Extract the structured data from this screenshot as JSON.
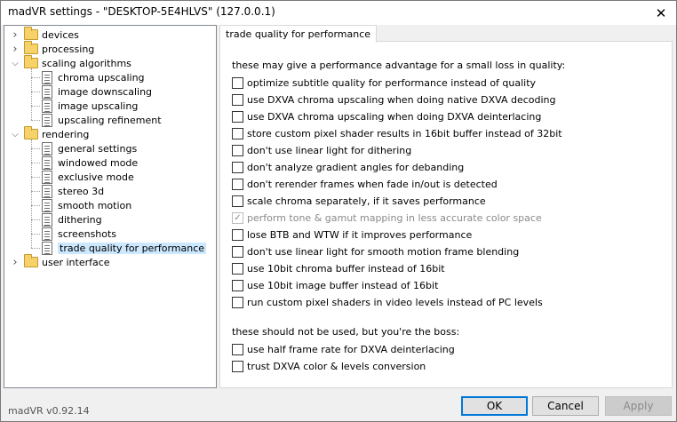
{
  "window": {
    "title": "madVR settings - \"DESKTOP-5E4HLVS\" (127.0.0.1)",
    "close_glyph": "✕"
  },
  "tree": {
    "items": [
      {
        "label": "devices",
        "type": "folder"
      },
      {
        "label": "processing",
        "type": "folder"
      },
      {
        "label": "scaling algorithms",
        "type": "folder"
      },
      {
        "label": "chroma upscaling",
        "type": "page"
      },
      {
        "label": "image downscaling",
        "type": "page"
      },
      {
        "label": "image upscaling",
        "type": "page"
      },
      {
        "label": "upscaling refinement",
        "type": "page"
      },
      {
        "label": "rendering",
        "type": "folder"
      },
      {
        "label": "general settings",
        "type": "page"
      },
      {
        "label": "windowed mode",
        "type": "page"
      },
      {
        "label": "exclusive mode",
        "type": "page"
      },
      {
        "label": "stereo 3d",
        "type": "page"
      },
      {
        "label": "smooth motion",
        "type": "page"
      },
      {
        "label": "dithering",
        "type": "page"
      },
      {
        "label": "screenshots",
        "type": "page"
      },
      {
        "label": "trade quality for performance",
        "type": "page",
        "selected": true
      },
      {
        "label": "user interface",
        "type": "folder"
      }
    ]
  },
  "panel": {
    "tab_label": "trade quality for performance",
    "section1_heading": "these may give a performance advantage for a small loss in quality:",
    "section1_options": [
      {
        "label": "optimize subtitle quality for performance instead of quality",
        "checked": false
      },
      {
        "label": "use DXVA chroma upscaling when doing native DXVA decoding",
        "checked": false
      },
      {
        "label": "use DXVA chroma upscaling when doing DXVA deinterlacing",
        "checked": false
      },
      {
        "label": "store custom pixel shader results in 16bit buffer instead of 32bit",
        "checked": false
      },
      {
        "label": "don't use linear light for dithering",
        "checked": false
      },
      {
        "label": "don't analyze gradient angles for debanding",
        "checked": false
      },
      {
        "label": "don't rerender frames when fade in/out is detected",
        "checked": false
      },
      {
        "label": "scale chroma separately, if it saves performance",
        "checked": false
      },
      {
        "label": "perform tone & gamut mapping in less accurate color space",
        "checked": true,
        "disabled": true
      },
      {
        "label": "lose BTB and WTW if it improves performance",
        "checked": false
      },
      {
        "label": "don't use linear light for smooth motion frame blending",
        "checked": false
      },
      {
        "label": "use 10bit chroma buffer instead of 16bit",
        "checked": false
      },
      {
        "label": "use 10bit image buffer instead of 16bit",
        "checked": false
      },
      {
        "label": "run custom pixel shaders in video levels instead of PC levels",
        "checked": false
      }
    ],
    "section2_heading": "these should not be used, but you're the boss:",
    "section2_options": [
      {
        "label": "use half frame rate for DXVA deinterlacing",
        "checked": false
      },
      {
        "label": "trust DXVA color & levels conversion",
        "checked": false
      }
    ]
  },
  "footer": {
    "version": "madVR v0.92.14",
    "ok_label": "OK",
    "cancel_label": "Cancel",
    "apply_label": "Apply"
  }
}
